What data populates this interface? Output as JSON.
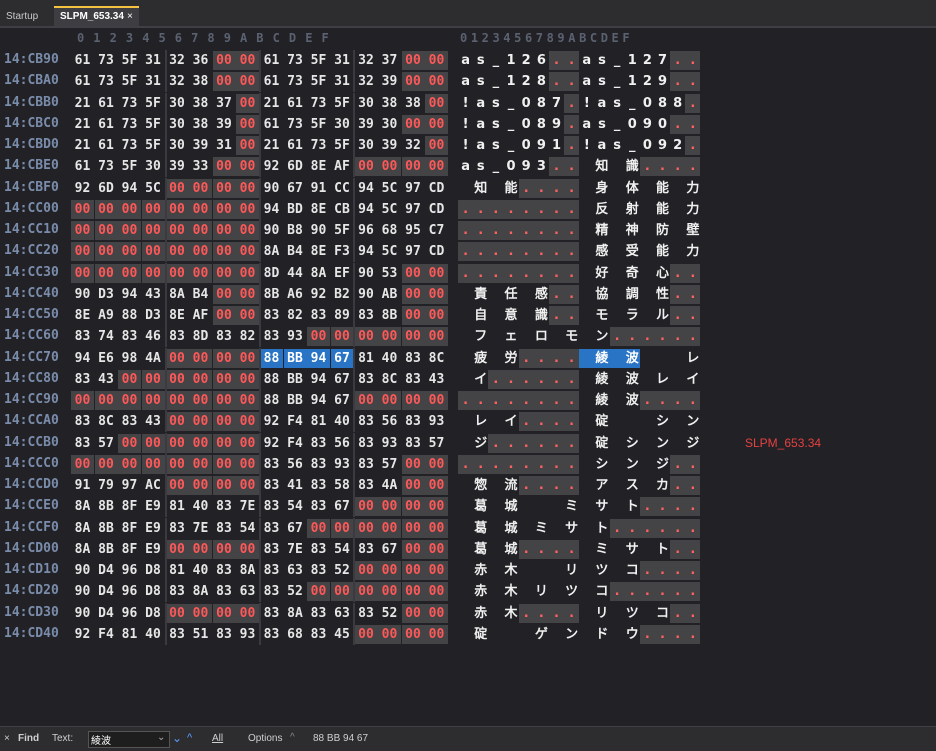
{
  "tabs": [
    {
      "label": "Startup"
    },
    {
      "label": "SLPM_653.34",
      "close": "×"
    }
  ],
  "column_header": {
    "hex": [
      "0",
      "1",
      "2",
      "3",
      "4",
      "5",
      "6",
      "7",
      "8",
      "9",
      "A",
      "B",
      "C",
      "D",
      "E",
      "F"
    ],
    "text": "0123456789ABCDEF"
  },
  "rows": [
    {
      "addr": "14:CB90",
      "hex": [
        "61",
        "73",
        "5F",
        "31",
        "32",
        "36",
        "00",
        "00",
        "61",
        "73",
        "5F",
        "31",
        "32",
        "37",
        "00",
        "00"
      ],
      "text": [
        "a",
        "s",
        "_",
        "1",
        "2",
        "6",
        ".",
        ".",
        "a",
        "s",
        "_",
        "1",
        "2",
        "7",
        ".",
        "."
      ]
    },
    {
      "addr": "14:CBA0",
      "hex": [
        "61",
        "73",
        "5F",
        "31",
        "32",
        "38",
        "00",
        "00",
        "61",
        "73",
        "5F",
        "31",
        "32",
        "39",
        "00",
        "00"
      ],
      "text": [
        "a",
        "s",
        "_",
        "1",
        "2",
        "8",
        ".",
        ".",
        "a",
        "s",
        "_",
        "1",
        "2",
        "9",
        ".",
        "."
      ]
    },
    {
      "addr": "14:CBB0",
      "hex": [
        "21",
        "61",
        "73",
        "5F",
        "30",
        "38",
        "37",
        "00",
        "21",
        "61",
        "73",
        "5F",
        "30",
        "38",
        "38",
        "00"
      ],
      "text": [
        "!",
        "a",
        "s",
        "_",
        "0",
        "8",
        "7",
        ".",
        "!",
        "a",
        "s",
        "_",
        "0",
        "8",
        "8",
        "."
      ]
    },
    {
      "addr": "14:CBC0",
      "hex": [
        "21",
        "61",
        "73",
        "5F",
        "30",
        "38",
        "39",
        "00",
        "61",
        "73",
        "5F",
        "30",
        "39",
        "30",
        "00",
        "00"
      ],
      "text": [
        "!",
        "a",
        "s",
        "_",
        "0",
        "8",
        "9",
        ".",
        "a",
        "s",
        "_",
        "0",
        "9",
        "0",
        ".",
        "."
      ]
    },
    {
      "addr": "14:CBD0",
      "hex": [
        "21",
        "61",
        "73",
        "5F",
        "30",
        "39",
        "31",
        "00",
        "21",
        "61",
        "73",
        "5F",
        "30",
        "39",
        "32",
        "00"
      ],
      "text": [
        "!",
        "a",
        "s",
        "_",
        "0",
        "9",
        "1",
        ".",
        "!",
        "a",
        "s",
        "_",
        "0",
        "9",
        "2",
        "."
      ]
    },
    {
      "addr": "14:CBE0",
      "hex": [
        "61",
        "73",
        "5F",
        "30",
        "39",
        "33",
        "00",
        "00",
        "92",
        "6D",
        "8E",
        "AF",
        "00",
        "00",
        "00",
        "00"
      ],
      "text": [
        "a",
        "s",
        "_",
        "0",
        "9",
        "3",
        ".",
        ".",
        "",
        "知",
        "",
        "識",
        ".",
        ".",
        ".",
        "."
      ]
    },
    {
      "addr": "14:CBF0",
      "hex": [
        "92",
        "6D",
        "94",
        "5C",
        "00",
        "00",
        "00",
        "00",
        "90",
        "67",
        "91",
        "CC",
        "94",
        "5C",
        "97",
        "CD"
      ],
      "text": [
        "",
        "知",
        "",
        "能",
        ".",
        ".",
        ".",
        ".",
        "",
        "身",
        "",
        "体",
        "",
        "能",
        "",
        "力"
      ]
    },
    {
      "addr": "14:CC00",
      "hex": [
        "00",
        "00",
        "00",
        "00",
        "00",
        "00",
        "00",
        "00",
        "94",
        "BD",
        "8E",
        "CB",
        "94",
        "5C",
        "97",
        "CD"
      ],
      "text": [
        ".",
        ".",
        ".",
        ".",
        ".",
        ".",
        ".",
        ".",
        "",
        "反",
        "",
        "射",
        "",
        "能",
        "",
        "力"
      ]
    },
    {
      "addr": "14:CC10",
      "hex": [
        "00",
        "00",
        "00",
        "00",
        "00",
        "00",
        "00",
        "00",
        "90",
        "B8",
        "90",
        "5F",
        "96",
        "68",
        "95",
        "C7"
      ],
      "text": [
        ".",
        ".",
        ".",
        ".",
        ".",
        ".",
        ".",
        ".",
        "",
        "精",
        "",
        "神",
        "",
        "防",
        "",
        "壁"
      ]
    },
    {
      "addr": "14:CC20",
      "hex": [
        "00",
        "00",
        "00",
        "00",
        "00",
        "00",
        "00",
        "00",
        "8A",
        "B4",
        "8E",
        "F3",
        "94",
        "5C",
        "97",
        "CD"
      ],
      "text": [
        ".",
        ".",
        ".",
        ".",
        ".",
        ".",
        ".",
        ".",
        "",
        "感",
        "",
        "受",
        "",
        "能",
        "",
        "力"
      ]
    },
    {
      "addr": "14:CC30",
      "hex": [
        "00",
        "00",
        "00",
        "00",
        "00",
        "00",
        "00",
        "00",
        "8D",
        "44",
        "8A",
        "EF",
        "90",
        "53",
        "00",
        "00"
      ],
      "text": [
        ".",
        ".",
        ".",
        ".",
        ".",
        ".",
        ".",
        ".",
        "",
        "好",
        "",
        "奇",
        "",
        "心",
        ".",
        "."
      ]
    },
    {
      "addr": "14:CC40",
      "hex": [
        "90",
        "D3",
        "94",
        "43",
        "8A",
        "B4",
        "00",
        "00",
        "8B",
        "A6",
        "92",
        "B2",
        "90",
        "AB",
        "00",
        "00"
      ],
      "text": [
        "",
        "責",
        "",
        "任",
        "",
        "感",
        ".",
        ".",
        "",
        "協",
        "",
        "調",
        "",
        "性",
        ".",
        "."
      ]
    },
    {
      "addr": "14:CC50",
      "hex": [
        "8E",
        "A9",
        "88",
        "D3",
        "8E",
        "AF",
        "00",
        "00",
        "83",
        "82",
        "83",
        "89",
        "83",
        "8B",
        "00",
        "00"
      ],
      "text": [
        "",
        "自",
        "",
        "意",
        "",
        "識",
        ".",
        ".",
        "",
        "モ",
        "",
        "ラ",
        "",
        "ル",
        ".",
        "."
      ]
    },
    {
      "addr": "14:CC60",
      "hex": [
        "83",
        "74",
        "83",
        "46",
        "83",
        "8D",
        "83",
        "82",
        "83",
        "93",
        "00",
        "00",
        "00",
        "00",
        "00",
        "00"
      ],
      "text": [
        "",
        "フ",
        "",
        "ェ",
        "",
        "ロ",
        "",
        "モ",
        "",
        "ン",
        ".",
        ".",
        ".",
        ".",
        ".",
        "."
      ]
    },
    {
      "addr": "14:CC70",
      "hex": [
        "94",
        "E6",
        "98",
        "4A",
        "00",
        "00",
        "00",
        "00",
        "88",
        "BB",
        "94",
        "67",
        "81",
        "40",
        "83",
        "8C"
      ],
      "text": [
        "",
        "疲",
        "",
        "労",
        ".",
        ".",
        ".",
        ".",
        "",
        "綾",
        "",
        "波",
        "",
        "　",
        "",
        "レ"
      ]
    },
    {
      "addr": "14:CC80",
      "hex": [
        "83",
        "43",
        "00",
        "00",
        "00",
        "00",
        "00",
        "00",
        "88",
        "BB",
        "94",
        "67",
        "83",
        "8C",
        "83",
        "43"
      ],
      "text": [
        "",
        "イ",
        ".",
        ".",
        ".",
        ".",
        ".",
        ".",
        "",
        "綾",
        "",
        "波",
        "",
        "レ",
        "",
        "イ"
      ]
    },
    {
      "addr": "14:CC90",
      "hex": [
        "00",
        "00",
        "00",
        "00",
        "00",
        "00",
        "00",
        "00",
        "88",
        "BB",
        "94",
        "67",
        "00",
        "00",
        "00",
        "00"
      ],
      "text": [
        ".",
        ".",
        ".",
        ".",
        ".",
        ".",
        ".",
        ".",
        "",
        "綾",
        "",
        "波",
        ".",
        ".",
        ".",
        "."
      ]
    },
    {
      "addr": "14:CCA0",
      "hex": [
        "83",
        "8C",
        "83",
        "43",
        "00",
        "00",
        "00",
        "00",
        "92",
        "F4",
        "81",
        "40",
        "83",
        "56",
        "83",
        "93"
      ],
      "text": [
        "",
        "レ",
        "",
        "イ",
        ".",
        ".",
        ".",
        ".",
        "",
        "碇",
        "",
        "　",
        "",
        "シ",
        "",
        "ン"
      ]
    },
    {
      "addr": "14:CCB0",
      "hex": [
        "83",
        "57",
        "00",
        "00",
        "00",
        "00",
        "00",
        "00",
        "92",
        "F4",
        "83",
        "56",
        "83",
        "93",
        "83",
        "57"
      ],
      "text": [
        "",
        "ジ",
        ".",
        ".",
        ".",
        ".",
        ".",
        ".",
        "",
        "碇",
        "",
        "シ",
        "",
        "ン",
        "",
        "ジ"
      ]
    },
    {
      "addr": "14:CCC0",
      "hex": [
        "00",
        "00",
        "00",
        "00",
        "00",
        "00",
        "00",
        "00",
        "83",
        "56",
        "83",
        "93",
        "83",
        "57",
        "00",
        "00"
      ],
      "text": [
        ".",
        ".",
        ".",
        ".",
        ".",
        ".",
        ".",
        ".",
        "",
        "シ",
        "",
        "ン",
        "",
        "ジ",
        ".",
        "."
      ]
    },
    {
      "addr": "14:CCD0",
      "hex": [
        "91",
        "79",
        "97",
        "AC",
        "00",
        "00",
        "00",
        "00",
        "83",
        "41",
        "83",
        "58",
        "83",
        "4A",
        "00",
        "00"
      ],
      "text": [
        "",
        "惣",
        "",
        "流",
        ".",
        ".",
        ".",
        ".",
        "",
        "ア",
        "",
        "ス",
        "",
        "カ",
        ".",
        "."
      ]
    },
    {
      "addr": "14:CCE0",
      "hex": [
        "8A",
        "8B",
        "8F",
        "E9",
        "81",
        "40",
        "83",
        "7E",
        "83",
        "54",
        "83",
        "67",
        "00",
        "00",
        "00",
        "00"
      ],
      "text": [
        "",
        "葛",
        "",
        "城",
        "",
        "　",
        "",
        "ミ",
        "",
        "サ",
        "",
        "ト",
        ".",
        ".",
        ".",
        "."
      ]
    },
    {
      "addr": "14:CCF0",
      "hex": [
        "8A",
        "8B",
        "8F",
        "E9",
        "83",
        "7E",
        "83",
        "54",
        "83",
        "67",
        "00",
        "00",
        "00",
        "00",
        "00",
        "00"
      ],
      "text": [
        "",
        "葛",
        "",
        "城",
        "",
        "ミ",
        "",
        "サ",
        "",
        "ト",
        ".",
        ".",
        ".",
        ".",
        ".",
        "."
      ]
    },
    {
      "addr": "14:CD00",
      "hex": [
        "8A",
        "8B",
        "8F",
        "E9",
        "00",
        "00",
        "00",
        "00",
        "83",
        "7E",
        "83",
        "54",
        "83",
        "67",
        "00",
        "00"
      ],
      "text": [
        "",
        "葛",
        "",
        "城",
        ".",
        ".",
        ".",
        ".",
        "",
        "ミ",
        "",
        "サ",
        "",
        "ト",
        ".",
        "."
      ]
    },
    {
      "addr": "14:CD10",
      "hex": [
        "90",
        "D4",
        "96",
        "D8",
        "81",
        "40",
        "83",
        "8A",
        "83",
        "63",
        "83",
        "52",
        "00",
        "00",
        "00",
        "00"
      ],
      "text": [
        "",
        "赤",
        "",
        "木",
        "",
        "　",
        "",
        "リ",
        "",
        "ツ",
        "",
        "コ",
        ".",
        ".",
        ".",
        "."
      ]
    },
    {
      "addr": "14:CD20",
      "hex": [
        "90",
        "D4",
        "96",
        "D8",
        "83",
        "8A",
        "83",
        "63",
        "83",
        "52",
        "00",
        "00",
        "00",
        "00",
        "00",
        "00"
      ],
      "text": [
        "",
        "赤",
        "",
        "木",
        "",
        "リ",
        "",
        "ツ",
        "",
        "コ",
        ".",
        ".",
        ".",
        ".",
        ".",
        "."
      ]
    },
    {
      "addr": "14:CD30",
      "hex": [
        "90",
        "D4",
        "96",
        "D8",
        "00",
        "00",
        "00",
        "00",
        "83",
        "8A",
        "83",
        "63",
        "83",
        "52",
        "00",
        "00"
      ],
      "text": [
        "",
        "赤",
        "",
        "木",
        ".",
        ".",
        ".",
        ".",
        "",
        "リ",
        "",
        "ツ",
        "",
        "コ",
        ".",
        "."
      ]
    },
    {
      "addr": "14:CD40",
      "hex": [
        "92",
        "F4",
        "81",
        "40",
        "83",
        "51",
        "83",
        "93",
        "83",
        "68",
        "83",
        "45",
        "00",
        "00",
        "00",
        "00"
      ],
      "text": [
        "",
        "碇",
        "",
        "　",
        "",
        "ゲ",
        "",
        "ン",
        "",
        "ド",
        "",
        "ウ",
        ".",
        ".",
        ".",
        "."
      ]
    }
  ],
  "selection": {
    "row": 14,
    "start": 8,
    "end": 11
  },
  "file_label": "SLPM_653.34",
  "findbar": {
    "close": "×",
    "find": "Find",
    "text_label": "Text:",
    "query": "綾波",
    "all": "All",
    "options": "Options",
    "result": "88 BB 94 67"
  }
}
